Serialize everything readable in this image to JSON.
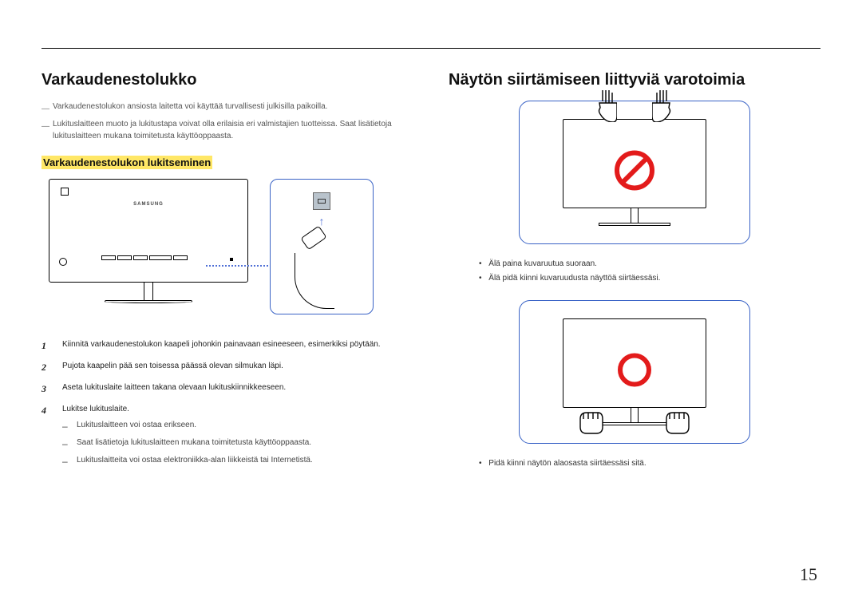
{
  "left": {
    "h2": "Varkaudenestolukko",
    "intro": [
      "Varkaudenestolukon ansiosta laitetta voi käyttää turvallisesti julkisilla paikoilla.",
      "Lukituslaitteen muoto ja lukitustapa voivat olla erilaisia eri valmistajien tuotteissa. Saat lisätietoja lukituslaitteen mukana toimitetusta käyttöoppaasta."
    ],
    "h3": "Varkaudenestolukon lukitseminen",
    "monitor_logo": "SAMSUNG",
    "steps": [
      "Kiinnitä varkaudenestolukon kaapeli johonkin painavaan esineeseen, esimerkiksi pöytään.",
      "Pujota kaapelin pää sen toisessa päässä olevan silmukan läpi.",
      "Aseta lukituslaite laitteen takana olevaan lukituskiinnikkeeseen.",
      "Lukitse lukituslaite."
    ],
    "step4_sub": [
      "Lukituslaitteen voi ostaa erikseen.",
      "Saat lisätietoja lukituslaitteen mukana toimitetusta käyttöoppaasta.",
      "Lukituslaitteita voi ostaa elektroniikka-alan liikkeistä tai Internetistä."
    ]
  },
  "right": {
    "h2": "Näytön siirtämiseen liittyviä varotoimia",
    "dont": [
      "Älä paina kuvaruutua suoraan.",
      "Älä pidä kiinni kuvaruudusta näyttöä siirtäessäsi."
    ],
    "do": [
      "Pidä kiinni näytön alaosasta siirtäessäsi sitä."
    ]
  },
  "page_number": "15"
}
